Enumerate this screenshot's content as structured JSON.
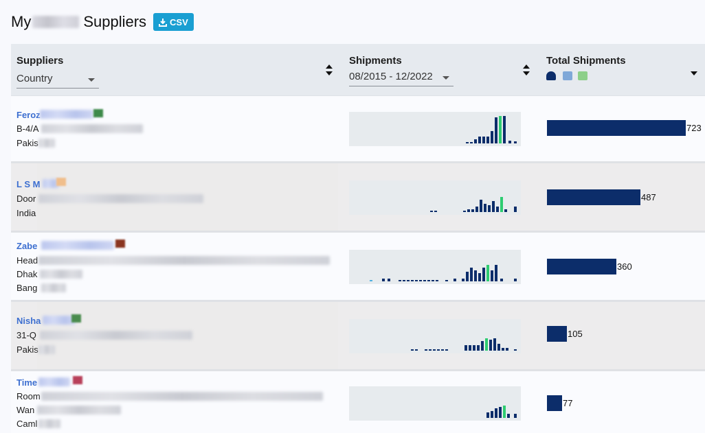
{
  "page": {
    "title_prefix": "My",
    "title_suffix": "Suppliers",
    "csv_label": "CSV"
  },
  "columns": {
    "suppliers": {
      "label": "Suppliers",
      "filter_value": "Country"
    },
    "shipments": {
      "label": "Shipments",
      "date_range": "08/2015 - 12/2022"
    },
    "total": {
      "label": "Total Shipments",
      "mode_icons": [
        "ship-icon",
        "bag-icon",
        "box-icon"
      ]
    }
  },
  "colors": {
    "bar": "#0c2d6a",
    "highlight": "#2ecc71",
    "accent": "#1a9fd2",
    "light_blue": "#4fb0e0"
  },
  "suppliers": [
    {
      "name": "Feroz",
      "lines": [
        "B-4/A",
        "Pakis"
      ],
      "total": 723,
      "total_label": "723",
      "spark": [
        [
          170,
          2
        ],
        [
          176,
          2
        ],
        [
          182,
          6
        ],
        [
          188,
          10
        ],
        [
          194,
          10
        ],
        [
          200,
          10
        ],
        [
          206,
          18
        ],
        [
          212,
          38
        ],
        [
          218,
          40,
          "g"
        ],
        [
          224,
          40
        ],
        [
          232,
          4
        ],
        [
          240,
          3
        ]
      ]
    },
    {
      "name": "L S M",
      "lines": [
        "Door",
        "India"
      ],
      "total": 487,
      "total_label": "487",
      "spark": [
        [
          118,
          2
        ],
        [
          124,
          2
        ],
        [
          166,
          2
        ],
        [
          172,
          4
        ],
        [
          178,
          4
        ],
        [
          184,
          8
        ],
        [
          190,
          18
        ],
        [
          196,
          12
        ],
        [
          202,
          10
        ],
        [
          208,
          16
        ],
        [
          214,
          8
        ],
        [
          220,
          22,
          "g"
        ],
        [
          226,
          4
        ],
        [
          240,
          8
        ]
      ]
    },
    {
      "name": "Zabe",
      "lines": [
        "Head",
        "Dhak",
        "Bang"
      ],
      "total": 360,
      "total_label": "360",
      "spark": [
        [
          30,
          2,
          "b"
        ],
        [
          48,
          4
        ],
        [
          56,
          4
        ],
        [
          72,
          2
        ],
        [
          78,
          2
        ],
        [
          84,
          2
        ],
        [
          90,
          2
        ],
        [
          96,
          2
        ],
        [
          102,
          2
        ],
        [
          108,
          2
        ],
        [
          114,
          2
        ],
        [
          120,
          2
        ],
        [
          126,
          2
        ],
        [
          140,
          2
        ],
        [
          152,
          4
        ],
        [
          164,
          4
        ],
        [
          170,
          14
        ],
        [
          176,
          20
        ],
        [
          182,
          16
        ],
        [
          188,
          12
        ],
        [
          194,
          20
        ],
        [
          200,
          24,
          "g"
        ],
        [
          206,
          16
        ],
        [
          212,
          24
        ],
        [
          220,
          4
        ],
        [
          240,
          4
        ]
      ]
    },
    {
      "name": "Nisha",
      "lines": [
        "31-Q",
        "Pakis"
      ],
      "total": 105,
      "total_label": "105",
      "spark": [
        [
          90,
          2
        ],
        [
          96,
          2
        ],
        [
          110,
          2
        ],
        [
          116,
          2
        ],
        [
          122,
          2
        ],
        [
          128,
          2
        ],
        [
          134,
          2
        ],
        [
          140,
          2
        ],
        [
          168,
          8
        ],
        [
          174,
          8
        ],
        [
          180,
          8
        ],
        [
          186,
          8
        ],
        [
          192,
          14
        ],
        [
          198,
          18,
          "g"
        ],
        [
          204,
          16
        ],
        [
          210,
          18
        ],
        [
          216,
          10
        ],
        [
          222,
          4
        ],
        [
          228,
          4
        ],
        [
          240,
          2
        ]
      ]
    },
    {
      "name": "Time",
      "lines": [
        "Room",
        "Wan",
        "Caml"
      ],
      "total": 77,
      "total_label": "77",
      "spark": [
        [
          200,
          8
        ],
        [
          206,
          10
        ],
        [
          212,
          14
        ],
        [
          218,
          16
        ],
        [
          224,
          18,
          "g"
        ],
        [
          230,
          6
        ],
        [
          240,
          6
        ]
      ]
    }
  ]
}
